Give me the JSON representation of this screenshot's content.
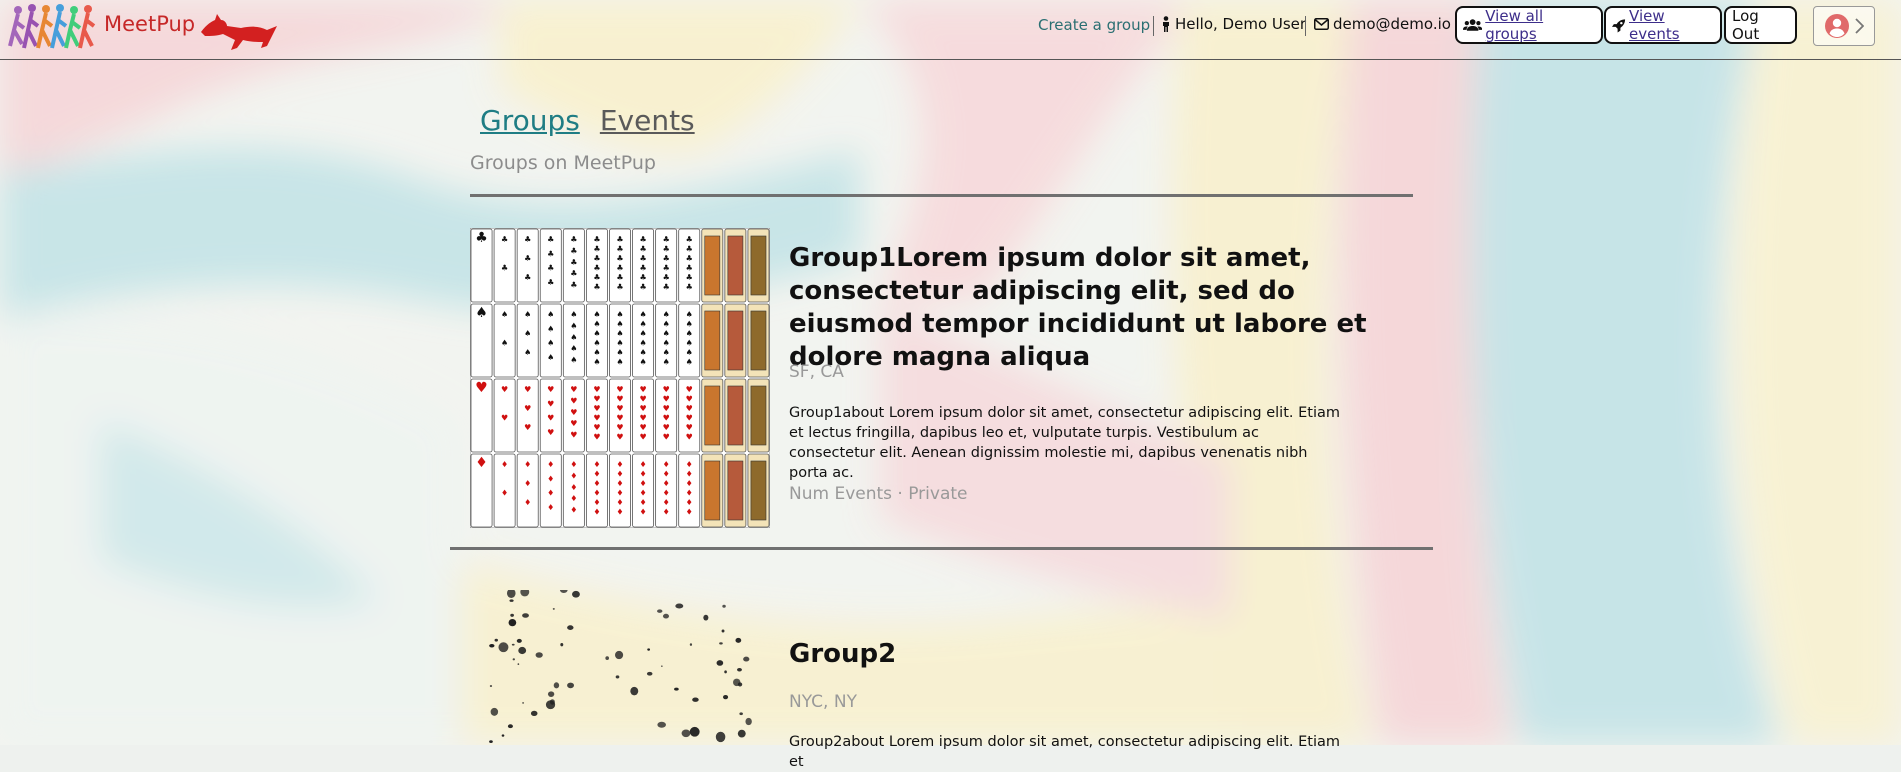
{
  "header": {
    "brand": "MeetPup",
    "create_group": "Create a group",
    "greeting": "Hello, Demo User",
    "email": "demo@demo.io",
    "view_all_groups": "View all groups",
    "view_events": "View events",
    "logout": "Log Out"
  },
  "tabs": [
    {
      "label": "Groups",
      "active": true
    },
    {
      "label": "Events",
      "active": false
    }
  ],
  "subtitle": "Groups on MeetPup",
  "groups": [
    {
      "title": "Group1Lorem ipsum dolor sit amet, consectetur adipiscing elit, sed do eiusmod tempor incididunt ut labore et dolore magna aliqua",
      "location": "SF, CA",
      "about": "Group1about Lorem ipsum dolor sit amet, consectetur adipiscing elit. Etiam et lectus fringilla, dapibus leo et, vulputate turpis. Vestibulum ac consectetur elit. Aenean dignissim molestie mi, dapibus venenatis nibh porta ac.",
      "meta": "Num Events · Private",
      "image": "playing-cards-grid"
    },
    {
      "title": "Group2",
      "location": "NYC, NY",
      "about": "Group2about Lorem ipsum dolor sit amet, consectetur adipiscing elit. Etiam et",
      "image": "ink-splatter"
    }
  ],
  "colors": {
    "brand_red": "#c62828",
    "tab_active": "#1f7d84",
    "muted_text": "#999999"
  },
  "icons": [
    "runners-logo",
    "dog-icon",
    "person-icon",
    "envelope-icon",
    "users-icon",
    "rocket-icon",
    "user-circle-icon",
    "chevron-right-icon"
  ]
}
